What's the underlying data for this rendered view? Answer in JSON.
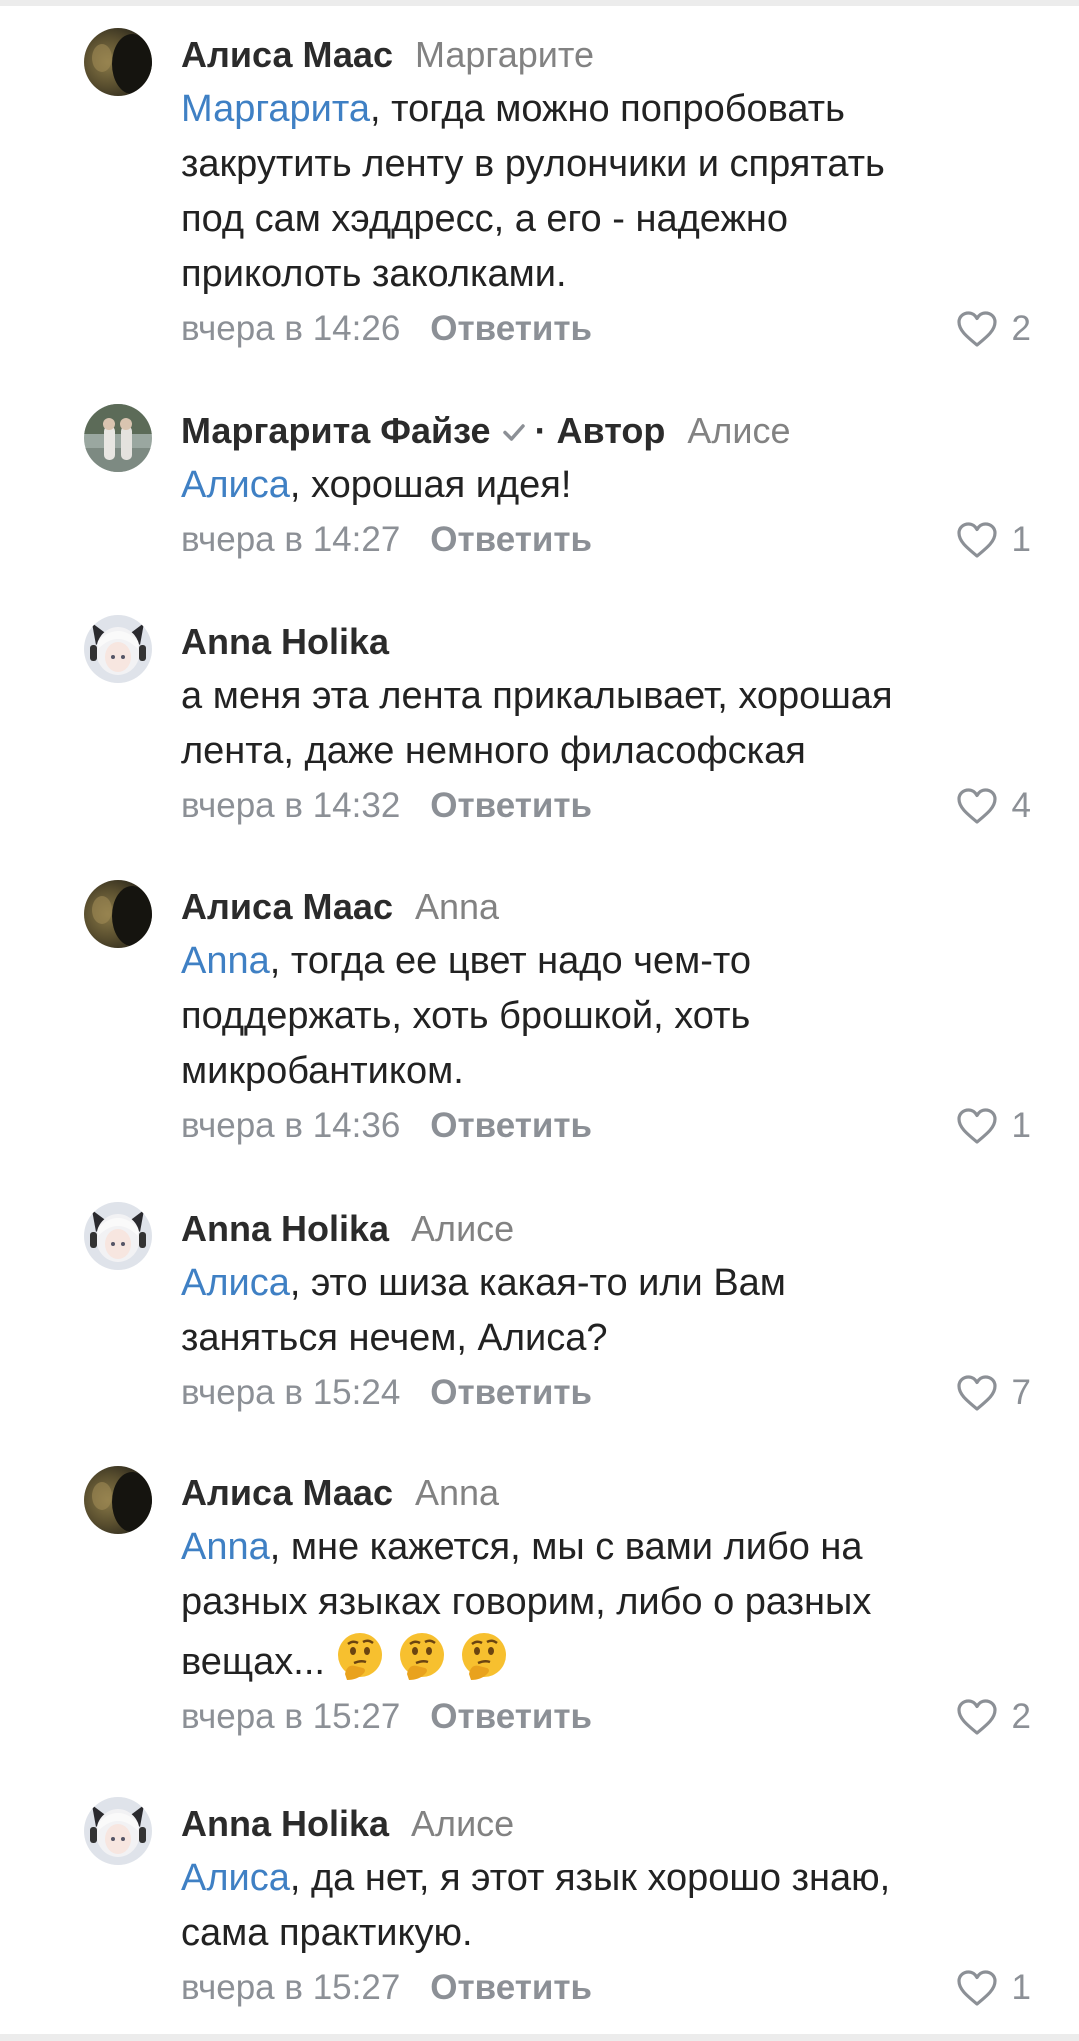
{
  "colors": {
    "mention": "#3f80c4",
    "meta": "#8c9096",
    "text": "#222222",
    "verified": "#8c9096"
  },
  "comments": [
    {
      "author": "Алиса Маас",
      "reply_to": "Маргарите",
      "mention": "Маргарита",
      "lines": [
        ", тогда можно попробовать",
        "закрутить ленту в рулончики и спрятать",
        "под сам хэддресс, а его - надежно",
        "приколоть заколками."
      ],
      "date": "вчера в 14:26",
      "reply_label": "Ответить",
      "likes": "2",
      "avatar_icon": "avatar-dark-photo-icon"
    },
    {
      "author": "Маргарита Файзе",
      "author_tag": "· Автор",
      "verified": true,
      "reply_to": "Алисе",
      "mention": "Алиса",
      "lines": [
        ", хорошая идея!"
      ],
      "date": "вчера в 14:27",
      "reply_label": "Ответить",
      "likes": "1",
      "avatar_icon": "avatar-outdoor-photo-icon"
    },
    {
      "author": "Anna Holika",
      "reply_to": "",
      "mention": "",
      "lines": [
        "а меня эта лента прикалывает, хорошая",
        "лента, даже немного филасофская"
      ],
      "date": "вчера в 14:32",
      "reply_label": "Ответить",
      "likes": "4",
      "avatar_icon": "avatar-anime-girl-icon"
    },
    {
      "author": "Алиса Маас",
      "reply_to": "Anna",
      "mention": "Anna",
      "lines": [
        ", тогда ее цвет надо чем-то",
        "поддержать, хоть брошкой, хоть",
        "микробантиком."
      ],
      "date": "вчера в 14:36",
      "reply_label": "Ответить",
      "likes": "1",
      "avatar_icon": "avatar-dark-photo-icon"
    },
    {
      "author": "Anna Holika",
      "reply_to": "Алисе",
      "mention": "Алиса",
      "lines": [
        ", это шиза какая-то или Вам",
        "заняться нечем, Алиса?"
      ],
      "date": "вчера в 15:24",
      "reply_label": "Ответить",
      "likes": "7",
      "avatar_icon": "avatar-anime-girl-icon"
    },
    {
      "author": "Алиса Маас",
      "reply_to": "Anna",
      "mention": "Anna",
      "lines": [
        ", мне кажется, мы с вами либо на",
        "разных языках говорим, либо о разных",
        "вещах..."
      ],
      "emoji_count": 3,
      "emoji_icon": "thinking-face-emoji-icon",
      "date": "вчера в 15:27",
      "reply_label": "Ответить",
      "likes": "2",
      "avatar_icon": "avatar-dark-photo-icon"
    },
    {
      "author": "Anna Holika",
      "reply_to": "Алисе",
      "mention": "Алиса",
      "lines": [
        ", да нет, я этот язык хорошо знаю,",
        "сама практикую."
      ],
      "date": "вчера в 15:27",
      "reply_label": "Ответить",
      "likes": "1",
      "avatar_icon": "avatar-anime-girl-icon"
    }
  ]
}
